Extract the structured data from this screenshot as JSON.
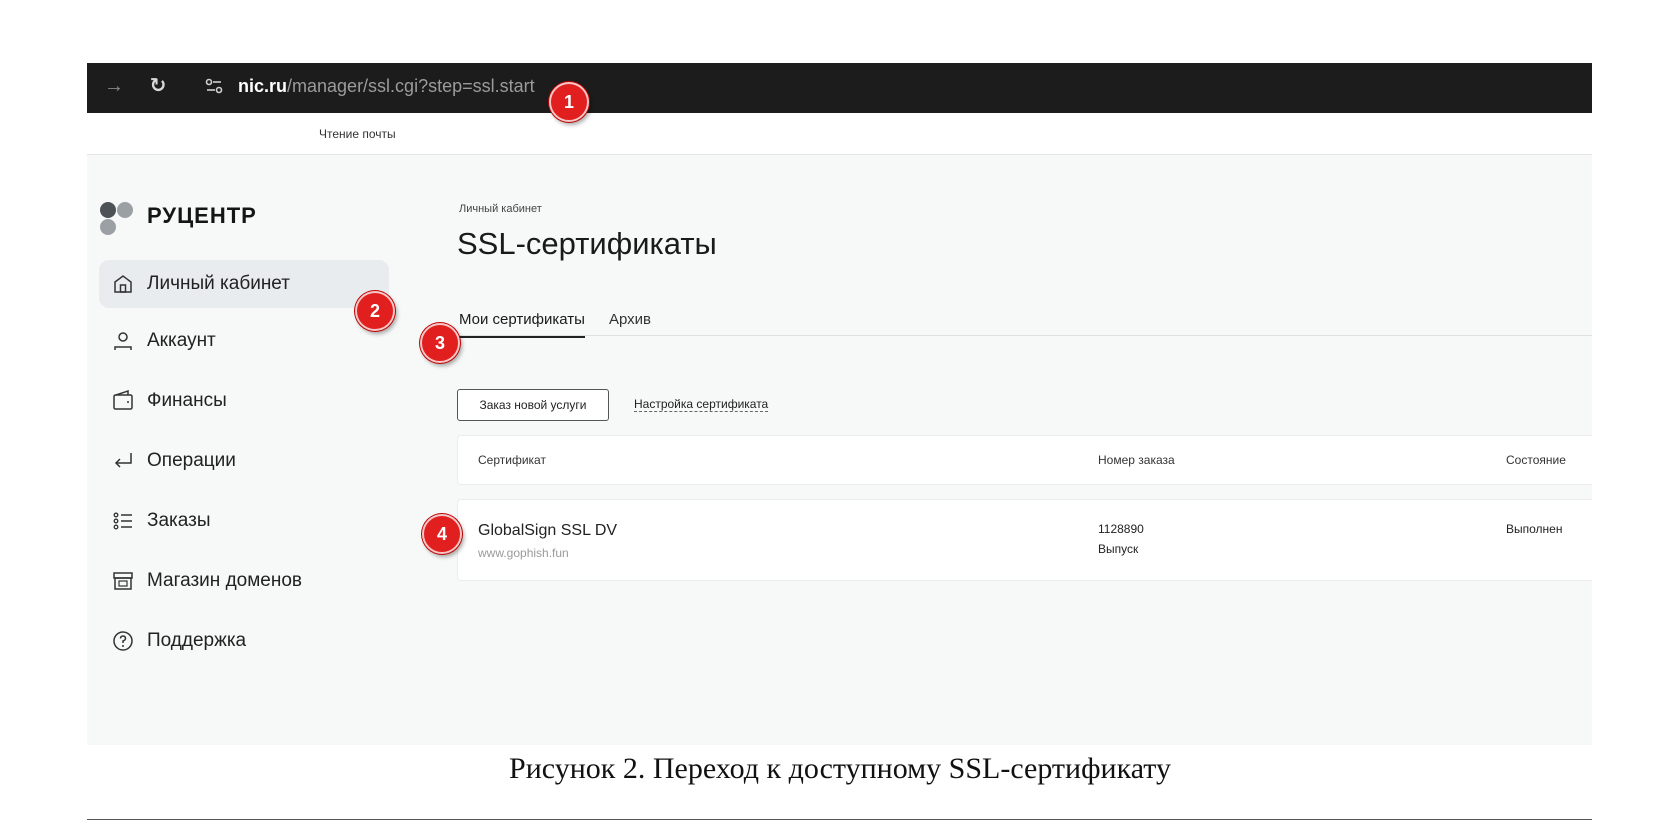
{
  "browser": {
    "url_host": "nic.ru",
    "url_path": "/manager/ssl.cgi?step=ssl.start"
  },
  "bookmarks": [
    "Чтение почты"
  ],
  "brand": {
    "name": "РУЦЕНТР"
  },
  "sidebar": {
    "items": [
      {
        "label": "Личный кабинет",
        "icon": "home-icon",
        "active": true
      },
      {
        "label": "Аккаунт",
        "icon": "user-icon"
      },
      {
        "label": "Финансы",
        "icon": "wallet-icon"
      },
      {
        "label": "Операции",
        "icon": "return-arrow-icon"
      },
      {
        "label": "Заказы",
        "icon": "list-icon"
      },
      {
        "label": "Магазин доменов",
        "icon": "shop-icon"
      },
      {
        "label": "Поддержка",
        "icon": "help-circle-icon"
      }
    ]
  },
  "main": {
    "breadcrumb": "Личный кабинет",
    "title": "SSL-сертификаты",
    "tabs": [
      {
        "label": "Мои сертификаты",
        "active": true
      },
      {
        "label": "Архив"
      }
    ],
    "order_button": "Заказ новой услуги",
    "setup_link": "Настройка сертификата",
    "table": {
      "columns": [
        "Сертификат",
        "Номер заказа",
        "Состояние"
      ],
      "rows": [
        {
          "certificate": "GlobalSign SSL DV",
          "domain": "www.gophish.fun",
          "order_number": "1128890",
          "order_type": "Выпуск",
          "status": "Выполнен"
        }
      ]
    }
  },
  "markers": [
    "1",
    "2",
    "3",
    "4"
  ],
  "caption": "Рисунок 2. Переход к доступному SSL-сертификату",
  "colors": {
    "marker": "#e11f1f",
    "browser_bar": "#1c1c1c",
    "active_item": "#e9ecee"
  }
}
